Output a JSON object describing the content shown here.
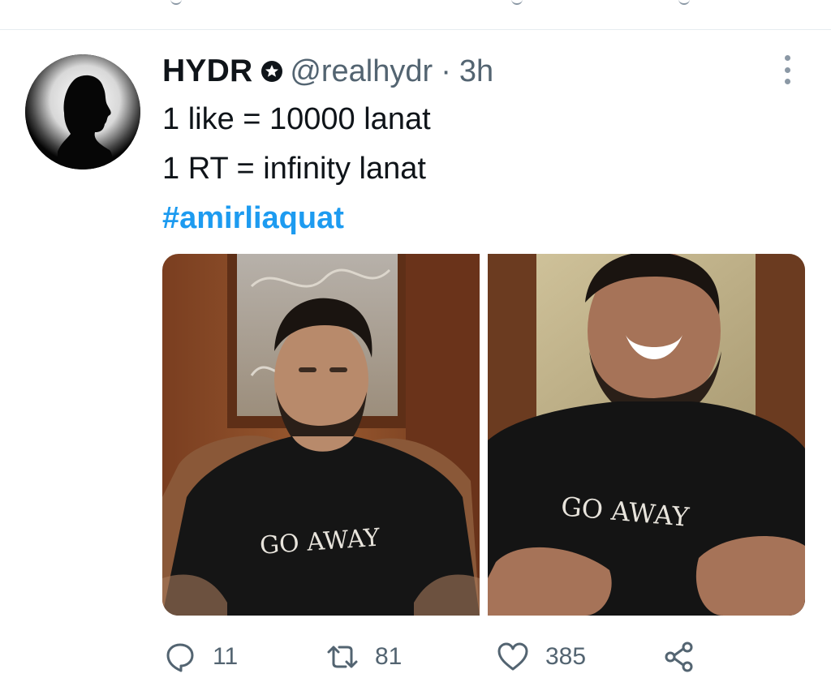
{
  "tweet": {
    "display_name": "HYDR",
    "badge_icon": "star-badge-icon",
    "handle": "@realhydr",
    "separator": "·",
    "time": "3h",
    "lines": [
      "1 like = 10000 lanat",
      "1 RT = infinity lanat"
    ],
    "hashtag": "#amirliaquat",
    "media": [
      {
        "shirt_text": "GO AWAY"
      },
      {
        "shirt_text": "GO AWAY"
      }
    ],
    "actions": {
      "reply": {
        "icon": "reply-icon",
        "count": "11"
      },
      "retweet": {
        "icon": "retweet-icon",
        "count": "81"
      },
      "like": {
        "icon": "heart-icon",
        "count": "385"
      },
      "share": {
        "icon": "share-icon"
      }
    }
  },
  "colors": {
    "text": "#0f1419",
    "secondary": "#536471",
    "link": "#1d9bf0",
    "divider": "#e6ecf0"
  }
}
